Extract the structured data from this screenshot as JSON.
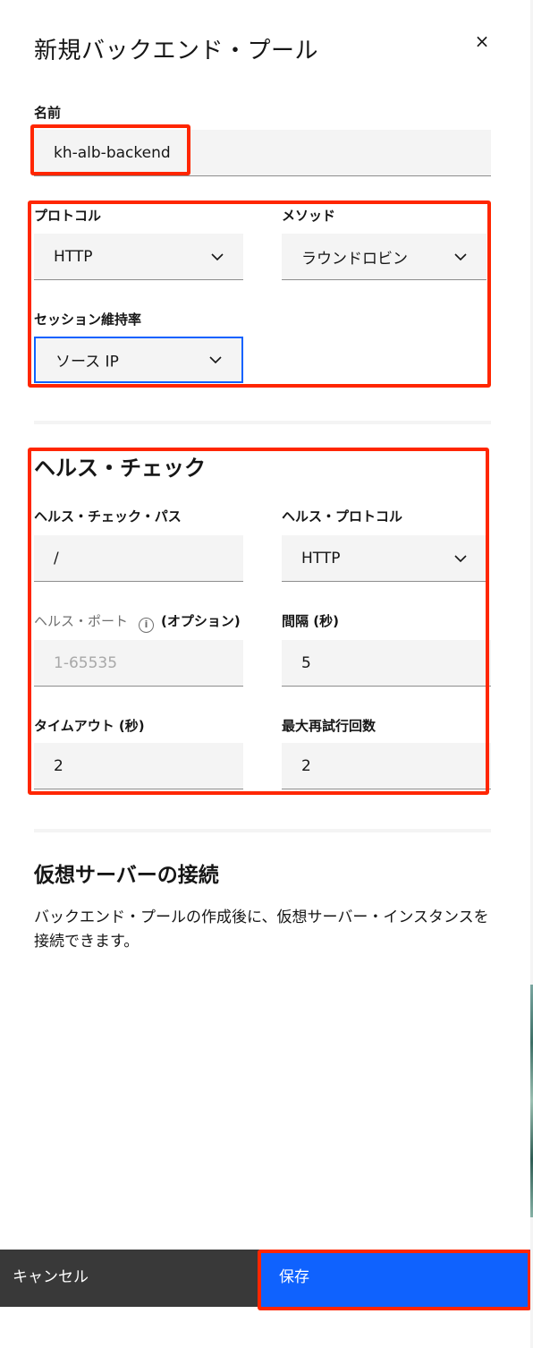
{
  "panel": {
    "title": "新規バックエンド・プール",
    "close_icon": "×"
  },
  "form": {
    "name": {
      "label": "名前",
      "value": "kh-alb-backend"
    },
    "protocol": {
      "label": "プロトコル",
      "value": "HTTP"
    },
    "method": {
      "label": "メソッド",
      "value": "ラウンドロビン"
    },
    "session": {
      "label": "セッション維持率",
      "value": "ソース IP"
    }
  },
  "health": {
    "heading": "ヘルス・チェック",
    "path": {
      "label": "ヘルス・チェック・パス",
      "value": "/"
    },
    "protocol": {
      "label": "ヘルス・プロトコル",
      "value": "HTTP"
    },
    "port": {
      "label": "ヘルス・ポート",
      "info_icon": "i",
      "optional": "(オプション)",
      "placeholder": "1-65535"
    },
    "interval": {
      "label": "間隔 (秒)",
      "value": "5"
    },
    "timeout": {
      "label": "タイムアウト (秒)",
      "value": "2"
    },
    "retries": {
      "label": "最大再試行回数",
      "value": "2"
    }
  },
  "attach": {
    "heading": "仮想サーバーの接続",
    "description": "バックエンド・プールの作成後に、仮想サーバー・インスタンスを接続できます。"
  },
  "footer": {
    "cancel_label": "キャンセル",
    "save_label": "保存"
  },
  "colors": {
    "primary": "#0f62fe",
    "cancel_bg": "#393939",
    "field_bg": "#f4f4f4",
    "annotation": "#ff2600"
  }
}
